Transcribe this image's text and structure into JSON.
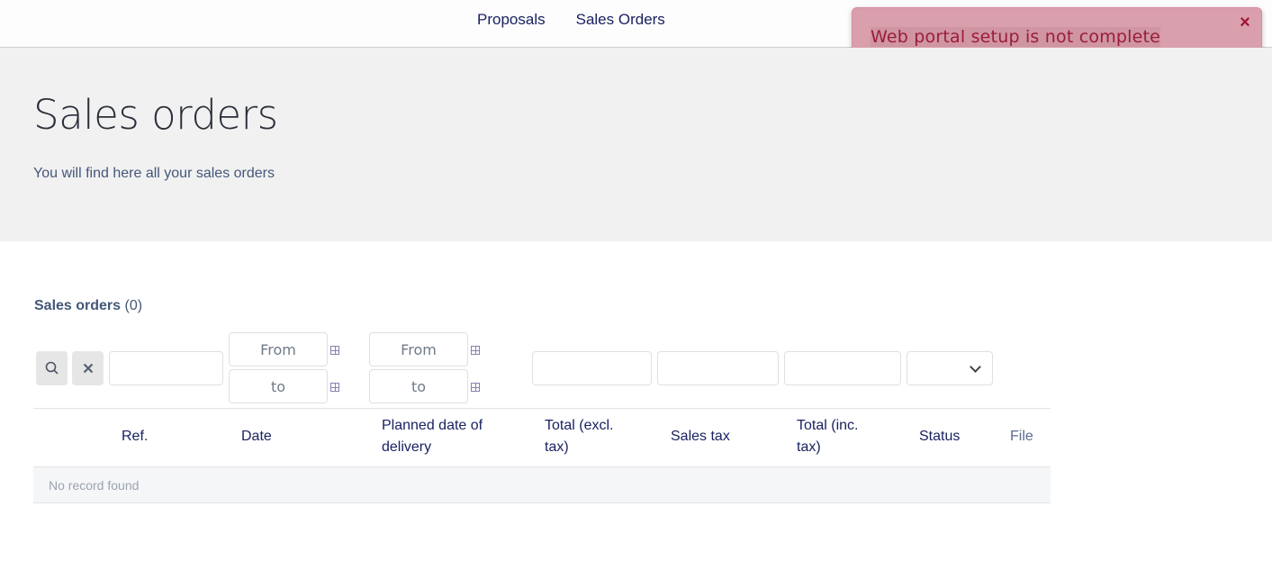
{
  "nav": {
    "items": [
      "Proposals",
      "Sales Orders"
    ]
  },
  "toast": {
    "message": "Web portal setup is not complete",
    "close": "×"
  },
  "hero": {
    "title": "Sales orders",
    "subtitle": "You will find here all your sales orders"
  },
  "section": {
    "title": "Sales orders",
    "count": "(0)"
  },
  "filters": {
    "date": {
      "from": "From",
      "to": "to"
    },
    "delivery": {
      "from": "From",
      "to": "to"
    }
  },
  "table": {
    "headers": [
      "Ref.",
      "Date",
      "Planned date of delivery",
      "Total (excl. tax)",
      "Sales tax",
      "Total (inc. tax)",
      "Status",
      "File"
    ],
    "empty_text": "No record found"
  },
  "colors": {
    "accent": "#1a2260",
    "toast_bg": "#d99fac",
    "toast_text": "#9b1c3a",
    "hero_bg": "#f1f1f1"
  }
}
